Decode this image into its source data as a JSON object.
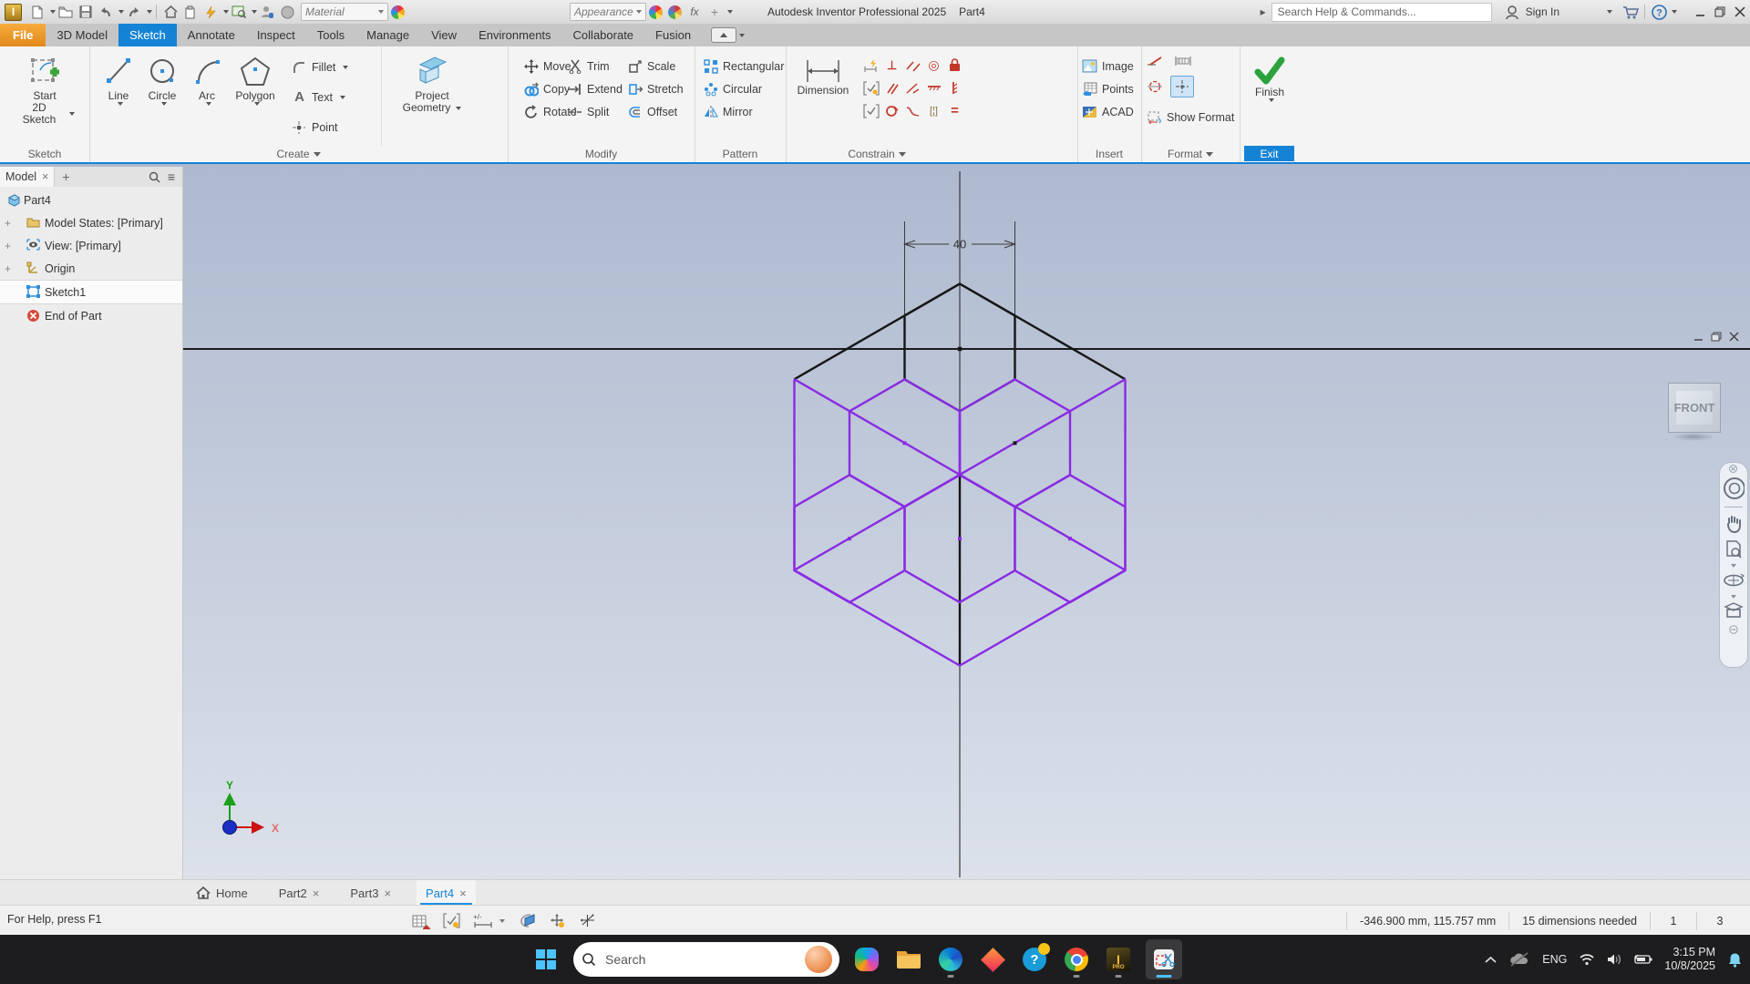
{
  "title_bar": {
    "app_title": "Autodesk Inventor Professional 2025",
    "doc_title": "Part4",
    "material_label": "Material",
    "appearance_label": "Appearance",
    "search_placeholder": "Search Help & Commands...",
    "sign_in_label": "Sign In"
  },
  "ribbon": {
    "tabs": [
      "File",
      "3D Model",
      "Sketch",
      "Annotate",
      "Inspect",
      "Tools",
      "Manage",
      "View",
      "Environments",
      "Collaborate",
      "Fusion"
    ],
    "active_tab": "Sketch",
    "sketch_panel": {
      "start_line1": "Start",
      "start_line2": "2D Sketch",
      "label": "Sketch"
    },
    "create_panel": {
      "line": "Line",
      "circle": "Circle",
      "arc": "Arc",
      "polygon": "Polygon",
      "fillet": "Fillet",
      "text": "Text",
      "point": "Point",
      "project_line1": "Project",
      "project_line2": "Geometry",
      "label": "Create"
    },
    "modify_panel": {
      "move": "Move",
      "copy": "Copy",
      "rotate": "Rotate",
      "trim": "Trim",
      "extend": "Extend",
      "split": "Split",
      "scale": "Scale",
      "stretch": "Stretch",
      "offset": "Offset",
      "label": "Modify"
    },
    "pattern_panel": {
      "rectangular": "Rectangular",
      "circular": "Circular",
      "mirror": "Mirror",
      "label": "Pattern"
    },
    "constrain_panel": {
      "dimension": "Dimension",
      "label": "Constrain"
    },
    "insert_panel": {
      "image": "Image",
      "points": "Points",
      "acad": "ACAD",
      "label": "Insert"
    },
    "format_panel": {
      "show_format": "Show Format",
      "label": "Format"
    },
    "exit_panel": {
      "finish": "Finish",
      "label": "Exit"
    }
  },
  "browser": {
    "tab_label": "Model",
    "items": [
      {
        "label": "Part4"
      },
      {
        "label": "Model States: [Primary]"
      },
      {
        "label": "View: [Primary]"
      },
      {
        "label": "Origin"
      },
      {
        "label": "Sketch1"
      },
      {
        "label": "End of Part"
      }
    ]
  },
  "canvas": {
    "viewcube_face": "FRONT",
    "dimension_value": "40",
    "axis_x_label": "X",
    "axis_y_label": "Y",
    "colors": {
      "sketch_purple": "#8a2be2",
      "sketch_black": "#161616",
      "canvas_top": "#aeb9cf",
      "canvas_bottom": "#dce1eb",
      "accent_blue": "#1583d5"
    }
  },
  "doc_tabs": {
    "home": "Home",
    "part2": "Part2",
    "part3": "Part3",
    "part4": "Part4"
  },
  "status_bar": {
    "help_text": "For Help, press F1",
    "coordinates": "-346.900 mm, 115.757 mm",
    "dimensions_needed": "15 dimensions needed",
    "field_a": "1",
    "field_b": "3"
  },
  "taskbar": {
    "search_placeholder": "Search",
    "language": "ENG",
    "time": "3:15 PM",
    "date": "10/8/2025"
  },
  "ui": {
    "close_glyph": "×",
    "plus_glyph": "+",
    "menu_glyph": "≡",
    "fx_glyph": "fx",
    "equal_glyph": "=",
    "perp_glyph": "⊥",
    "conc_glyph": "◎",
    "sym_glyph": "[¦]"
  }
}
